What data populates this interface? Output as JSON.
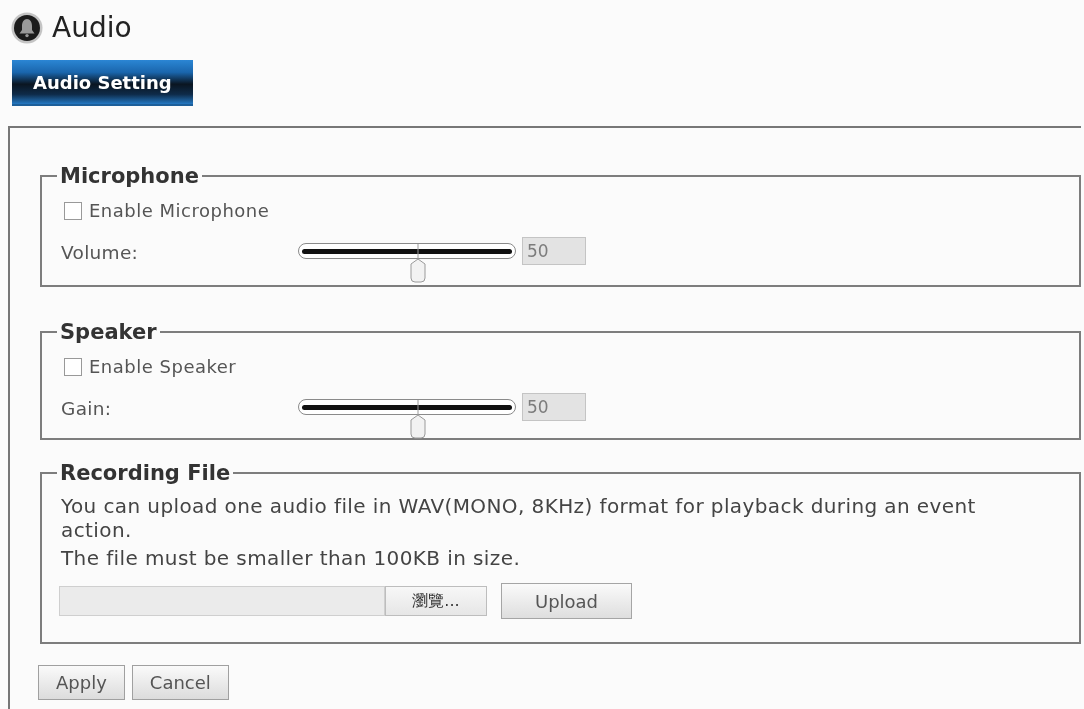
{
  "header": {
    "title": "Audio"
  },
  "tabs": [
    {
      "label": "Audio Setting",
      "selected": true
    }
  ],
  "groups": [
    {
      "legend": "Microphone",
      "checkbox": {
        "label": "Enable Microphone",
        "checked": false
      },
      "slider": {
        "label": "Volume:",
        "level": 0.55
      },
      "value_field": {
        "value": "50",
        "disabled": true
      }
    },
    {
      "legend": "Speaker",
      "checkbox": {
        "label": "Enable Speaker",
        "checked": false
      },
      "slider": {
        "label": "Gain:",
        "level": 0.55
      },
      "value_field": {
        "value": "50",
        "disabled": true
      }
    }
  ],
  "recording_file": {
    "legend": "Recording File",
    "paragraphs": [
      "You can upload one audio file in WAV(MONO, 8KHz) format for playback during an event action.",
      "The file must be smaller than 100KB in size."
    ],
    "browse_button": "瀏覽...",
    "upload_button": "Upload"
  },
  "buttons": [
    {
      "label": "Apply"
    },
    {
      "label": "Cancel"
    }
  ]
}
